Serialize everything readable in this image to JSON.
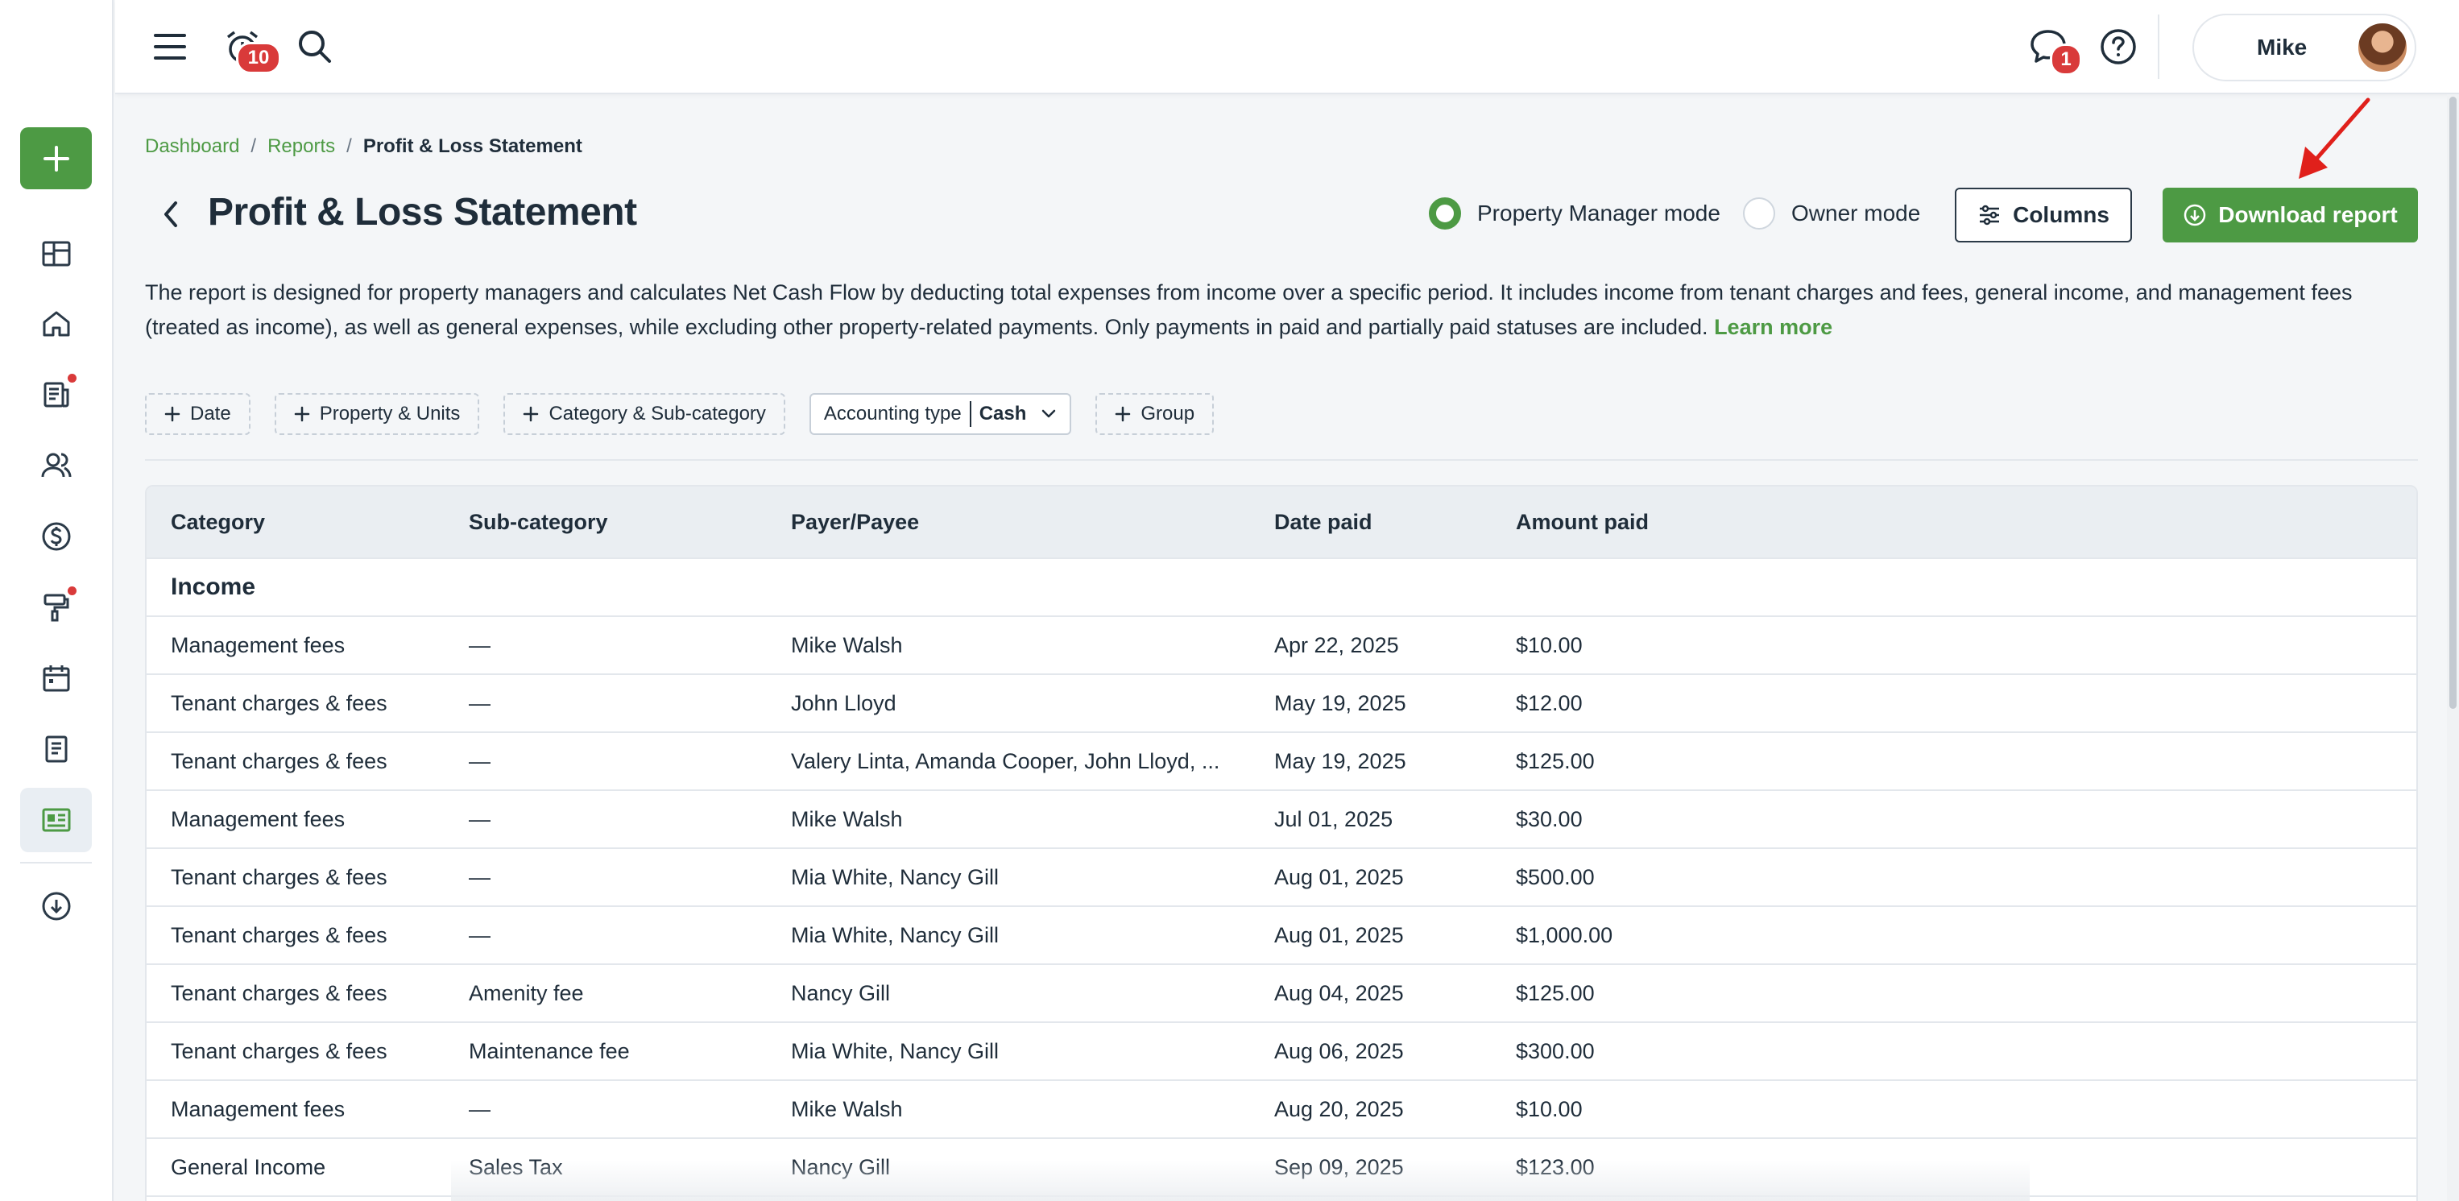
{
  "topbar": {
    "notifications_count": "10",
    "messages_count": "1",
    "user_name": "Mike"
  },
  "breadcrumb": {
    "items": [
      "Dashboard",
      "Reports"
    ],
    "current": "Profit & Loss Statement",
    "separator": "/"
  },
  "page": {
    "title": "Profit & Loss Statement",
    "mode_manager": "Property Manager mode",
    "mode_owner": "Owner mode",
    "columns_label": "Columns",
    "download_label": "Download report",
    "description": "The report is designed for property managers and calculates Net Cash Flow by deducting total expenses from income over a specific period. It includes income from tenant charges and fees, general income, and management fees (treated as income), as well as general expenses, while excluding other property-related payments. Only payments in paid and partially paid statuses are included.",
    "learn_more": "Learn more"
  },
  "filters": {
    "date": "Date",
    "property_units": "Property & Units",
    "category": "Category & Sub-category",
    "accounting_type_label": "Accounting type",
    "accounting_type_value": "Cash",
    "group": "Group"
  },
  "table": {
    "headers": [
      "Category",
      "Sub-category",
      "Payer/Payee",
      "Date paid",
      "Amount paid"
    ],
    "group_label": "Income",
    "rows": [
      {
        "category": "Management fees",
        "sub": "—",
        "payer": "Mike Walsh",
        "date": "Apr 22, 2025",
        "amount": "$10.00"
      },
      {
        "category": "Tenant charges & fees",
        "sub": "—",
        "payer": "John Lloyd",
        "date": "May 19, 2025",
        "amount": "$12.00"
      },
      {
        "category": "Tenant charges & fees",
        "sub": "—",
        "payer": "Valery Linta, Amanda Cooper, John Lloyd, ...",
        "date": "May 19, 2025",
        "amount": "$125.00"
      },
      {
        "category": "Management fees",
        "sub": "—",
        "payer": "Mike Walsh",
        "date": "Jul 01, 2025",
        "amount": "$30.00"
      },
      {
        "category": "Tenant charges & fees",
        "sub": "—",
        "payer": "Mia White, Nancy Gill",
        "date": "Aug 01, 2025",
        "amount": "$500.00"
      },
      {
        "category": "Tenant charges & fees",
        "sub": "—",
        "payer": "Mia White, Nancy Gill",
        "date": "Aug 01, 2025",
        "amount": "$1,000.00"
      },
      {
        "category": "Tenant charges & fees",
        "sub": "Amenity fee",
        "payer": "Nancy Gill",
        "date": "Aug 04, 2025",
        "amount": "$125.00"
      },
      {
        "category": "Tenant charges & fees",
        "sub": "Maintenance fee",
        "payer": "Mia White, Nancy Gill",
        "date": "Aug 06, 2025",
        "amount": "$300.00"
      },
      {
        "category": "Management fees",
        "sub": "—",
        "payer": "Mike Walsh",
        "date": "Aug 20, 2025",
        "amount": "$10.00"
      },
      {
        "category": "General Income",
        "sub": "Sales Tax",
        "payer": "Nancy Gill",
        "date": "Sep 09, 2025",
        "amount": "$123.00"
      }
    ]
  },
  "colors": {
    "brand_green": "#4d9a44",
    "badge_red": "#d93a3a",
    "text_dark": "#1f2d3a"
  },
  "sidebar": {
    "icons": [
      "add-icon",
      "dashboard-icon",
      "home-icon",
      "leasing-icon",
      "people-icon",
      "dollar-icon",
      "maintenance-icon",
      "calendar-icon",
      "document-icon",
      "reports-icon",
      "download-cloud-icon"
    ]
  }
}
